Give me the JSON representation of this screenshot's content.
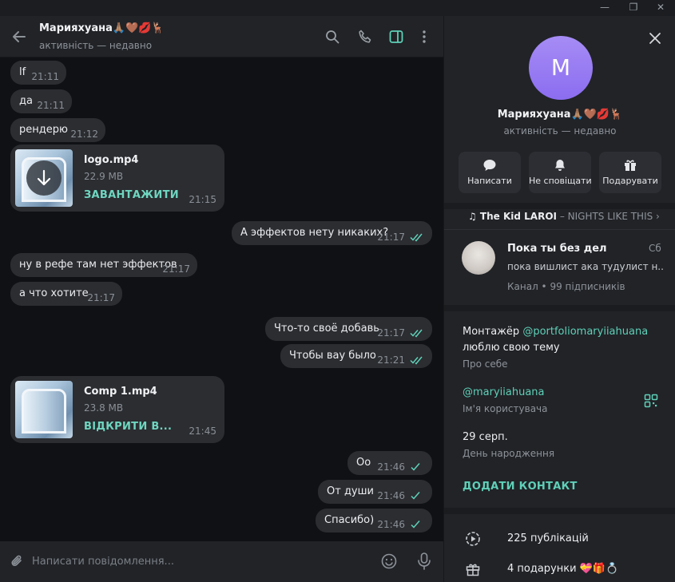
{
  "window": {
    "min_glyph": "—",
    "max_glyph": "❐",
    "close_glyph": "✕"
  },
  "chat": {
    "title": "Марияхуана🙏🏽🤎💋🦌",
    "status": "активність — недавно",
    "messages": [
      {
        "text": "lf",
        "time": "21:11"
      },
      {
        "text": "да",
        "time": "21:11"
      },
      {
        "text": "рендерю",
        "time": "21:12"
      },
      {
        "file": "logo.mp4",
        "size": "22.9 MB",
        "action": "ЗАВАНТАЖИТИ",
        "time": "21:15"
      },
      {
        "text": "А эффектов нету никаких?",
        "time": "21:17"
      },
      {
        "text": "ну в рефе там нет эффектов",
        "time": "21:17"
      },
      {
        "text": "а что хотите",
        "time": "21:17"
      },
      {
        "text": "Что-то своё добавь",
        "time": "21:17"
      },
      {
        "text": "Чтобы вау было",
        "time": "21:21"
      },
      {
        "file": "Comp 1.mp4",
        "size": "23.8 MB",
        "action": "ВІДКРИТИ В...",
        "time": "21:45"
      },
      {
        "text": "Оо",
        "time": "21:46"
      },
      {
        "text": "От души",
        "time": "21:46"
      },
      {
        "text": "Спасибо)",
        "time": "21:46"
      }
    ],
    "composer_placeholder": "Написати повідомлення..."
  },
  "profile": {
    "avatar_letter": "M",
    "name": "Марияхуана🙏🏽🤎💋🦌",
    "status": "активність — недавно",
    "actions": [
      "Написати",
      "Не сповіщати",
      "Подарувати"
    ],
    "music": {
      "artist": "♫ The Kid LAROI",
      "song": " – NIGHTS LIKE THIS ›"
    },
    "channel": {
      "title": "Пока ты без дел",
      "day": "Сб",
      "last_message": "пока вишлист ака тудулист н...",
      "meta": "Канал • 99 підписників"
    },
    "bio_text": "Монтажёр ",
    "bio_link": "@portfoliomaryiiahuana",
    "bio_line2": "люблю свою тему",
    "bio_label": "Про себе",
    "username": "@maryiiahuana",
    "username_label": "Ім'я користувача",
    "birthday": "29 серп.",
    "birthday_label": "День народження",
    "add_contact": "ДОДАТИ КОНТАКТ",
    "posts": "225 публікацій",
    "gifts": "4 подарунки 💝🎁💍"
  },
  "colors": {
    "accent": "#5fd0b8",
    "avatar": "#9b7ff2",
    "bubble": "#2b2d31"
  }
}
